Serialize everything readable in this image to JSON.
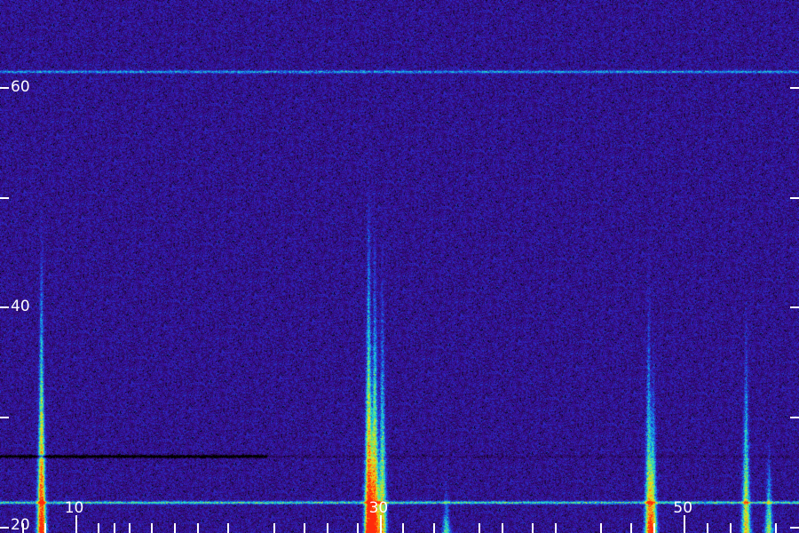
{
  "chart_data": {
    "type": "heatmap",
    "title": "",
    "xlabel": "",
    "ylabel": "",
    "xlim": [
      5,
      57.5
    ],
    "ylim": [
      19.5,
      68
    ],
    "x_ticks": [
      {
        "value": 10,
        "label": "10"
      },
      {
        "value": 30,
        "label": "30"
      },
      {
        "value": 50,
        "label": "50"
      }
    ],
    "x_minor_ticks": [
      6.5,
      8.0,
      11.5,
      12.5,
      13.5,
      15,
      16.5,
      18,
      20,
      23,
      25,
      26.5,
      28.5,
      31.5,
      33.5,
      36.5,
      38,
      40,
      41.5,
      44.5,
      46.5,
      48,
      51.5,
      53,
      56
    ],
    "y_ticks": [
      {
        "value": 20,
        "label": "20"
      },
      {
        "value": 30,
        "label": ""
      },
      {
        "value": 40,
        "label": "40"
      },
      {
        "value": 50,
        "label": ""
      },
      {
        "value": 60,
        "label": "60"
      }
    ],
    "colormap": [
      "#000000",
      "#2a0a5c",
      "#3a0fa0",
      "#1f3fd9",
      "#12a0e6",
      "#27e0c8",
      "#9fe83a",
      "#f2e21c",
      "#ff8a10",
      "#ff2a0a"
    ],
    "background_level": 0.2,
    "features": [
      {
        "x": 7.7,
        "y_start": 19.5,
        "y_end": 51,
        "peak_intensity": 0.97
      },
      {
        "x": 29.2,
        "y_start": 19.5,
        "y_end": 56,
        "peak_intensity": 0.95
      },
      {
        "x": 29.6,
        "y_start": 19.5,
        "y_end": 52,
        "peak_intensity": 0.8
      },
      {
        "x": 30.1,
        "y_start": 19.5,
        "y_end": 49,
        "peak_intensity": 0.6
      },
      {
        "x": 47.6,
        "y_start": 19.5,
        "y_end": 46,
        "peak_intensity": 0.6
      },
      {
        "x": 47.9,
        "y_start": 19.5,
        "y_end": 40,
        "peak_intensity": 0.5
      },
      {
        "x": 54.0,
        "y_start": 19.5,
        "y_end": 43,
        "peak_intensity": 0.6
      },
      {
        "x": 55.5,
        "y_start": 19.5,
        "y_end": 30,
        "peak_intensity": 0.45
      },
      {
        "x": 34.3,
        "y_start": 19.5,
        "y_end": 25,
        "peak_intensity": 0.35
      }
    ],
    "horizontal_bands": [
      {
        "y": 61.5,
        "intensity": 0.3
      },
      {
        "y": 26.5,
        "intensity": -0.4
      },
      {
        "y": 22.3,
        "intensity": 0.45
      }
    ],
    "grid": false,
    "legend": "none"
  }
}
